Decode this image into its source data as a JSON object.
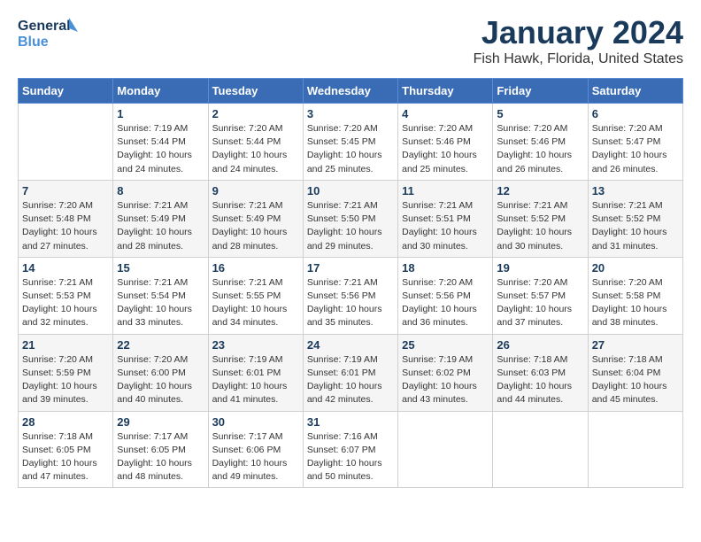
{
  "logo": {
    "line1": "General",
    "line2": "Blue"
  },
  "header": {
    "month": "January 2024",
    "location": "Fish Hawk, Florida, United States"
  },
  "weekdays": [
    "Sunday",
    "Monday",
    "Tuesday",
    "Wednesday",
    "Thursday",
    "Friday",
    "Saturday"
  ],
  "weeks": [
    [
      {
        "day": "",
        "info": ""
      },
      {
        "day": "1",
        "info": "Sunrise: 7:19 AM\nSunset: 5:44 PM\nDaylight: 10 hours\nand 24 minutes."
      },
      {
        "day": "2",
        "info": "Sunrise: 7:20 AM\nSunset: 5:44 PM\nDaylight: 10 hours\nand 24 minutes."
      },
      {
        "day": "3",
        "info": "Sunrise: 7:20 AM\nSunset: 5:45 PM\nDaylight: 10 hours\nand 25 minutes."
      },
      {
        "day": "4",
        "info": "Sunrise: 7:20 AM\nSunset: 5:46 PM\nDaylight: 10 hours\nand 25 minutes."
      },
      {
        "day": "5",
        "info": "Sunrise: 7:20 AM\nSunset: 5:46 PM\nDaylight: 10 hours\nand 26 minutes."
      },
      {
        "day": "6",
        "info": "Sunrise: 7:20 AM\nSunset: 5:47 PM\nDaylight: 10 hours\nand 26 minutes."
      }
    ],
    [
      {
        "day": "7",
        "info": "Sunrise: 7:20 AM\nSunset: 5:48 PM\nDaylight: 10 hours\nand 27 minutes."
      },
      {
        "day": "8",
        "info": "Sunrise: 7:21 AM\nSunset: 5:49 PM\nDaylight: 10 hours\nand 28 minutes."
      },
      {
        "day": "9",
        "info": "Sunrise: 7:21 AM\nSunset: 5:49 PM\nDaylight: 10 hours\nand 28 minutes."
      },
      {
        "day": "10",
        "info": "Sunrise: 7:21 AM\nSunset: 5:50 PM\nDaylight: 10 hours\nand 29 minutes."
      },
      {
        "day": "11",
        "info": "Sunrise: 7:21 AM\nSunset: 5:51 PM\nDaylight: 10 hours\nand 30 minutes."
      },
      {
        "day": "12",
        "info": "Sunrise: 7:21 AM\nSunset: 5:52 PM\nDaylight: 10 hours\nand 30 minutes."
      },
      {
        "day": "13",
        "info": "Sunrise: 7:21 AM\nSunset: 5:52 PM\nDaylight: 10 hours\nand 31 minutes."
      }
    ],
    [
      {
        "day": "14",
        "info": "Sunrise: 7:21 AM\nSunset: 5:53 PM\nDaylight: 10 hours\nand 32 minutes."
      },
      {
        "day": "15",
        "info": "Sunrise: 7:21 AM\nSunset: 5:54 PM\nDaylight: 10 hours\nand 33 minutes."
      },
      {
        "day": "16",
        "info": "Sunrise: 7:21 AM\nSunset: 5:55 PM\nDaylight: 10 hours\nand 34 minutes."
      },
      {
        "day": "17",
        "info": "Sunrise: 7:21 AM\nSunset: 5:56 PM\nDaylight: 10 hours\nand 35 minutes."
      },
      {
        "day": "18",
        "info": "Sunrise: 7:20 AM\nSunset: 5:56 PM\nDaylight: 10 hours\nand 36 minutes."
      },
      {
        "day": "19",
        "info": "Sunrise: 7:20 AM\nSunset: 5:57 PM\nDaylight: 10 hours\nand 37 minutes."
      },
      {
        "day": "20",
        "info": "Sunrise: 7:20 AM\nSunset: 5:58 PM\nDaylight: 10 hours\nand 38 minutes."
      }
    ],
    [
      {
        "day": "21",
        "info": "Sunrise: 7:20 AM\nSunset: 5:59 PM\nDaylight: 10 hours\nand 39 minutes."
      },
      {
        "day": "22",
        "info": "Sunrise: 7:20 AM\nSunset: 6:00 PM\nDaylight: 10 hours\nand 40 minutes."
      },
      {
        "day": "23",
        "info": "Sunrise: 7:19 AM\nSunset: 6:01 PM\nDaylight: 10 hours\nand 41 minutes."
      },
      {
        "day": "24",
        "info": "Sunrise: 7:19 AM\nSunset: 6:01 PM\nDaylight: 10 hours\nand 42 minutes."
      },
      {
        "day": "25",
        "info": "Sunrise: 7:19 AM\nSunset: 6:02 PM\nDaylight: 10 hours\nand 43 minutes."
      },
      {
        "day": "26",
        "info": "Sunrise: 7:18 AM\nSunset: 6:03 PM\nDaylight: 10 hours\nand 44 minutes."
      },
      {
        "day": "27",
        "info": "Sunrise: 7:18 AM\nSunset: 6:04 PM\nDaylight: 10 hours\nand 45 minutes."
      }
    ],
    [
      {
        "day": "28",
        "info": "Sunrise: 7:18 AM\nSunset: 6:05 PM\nDaylight: 10 hours\nand 47 minutes."
      },
      {
        "day": "29",
        "info": "Sunrise: 7:17 AM\nSunset: 6:05 PM\nDaylight: 10 hours\nand 48 minutes."
      },
      {
        "day": "30",
        "info": "Sunrise: 7:17 AM\nSunset: 6:06 PM\nDaylight: 10 hours\nand 49 minutes."
      },
      {
        "day": "31",
        "info": "Sunrise: 7:16 AM\nSunset: 6:07 PM\nDaylight: 10 hours\nand 50 minutes."
      },
      {
        "day": "",
        "info": ""
      },
      {
        "day": "",
        "info": ""
      },
      {
        "day": "",
        "info": ""
      }
    ]
  ]
}
